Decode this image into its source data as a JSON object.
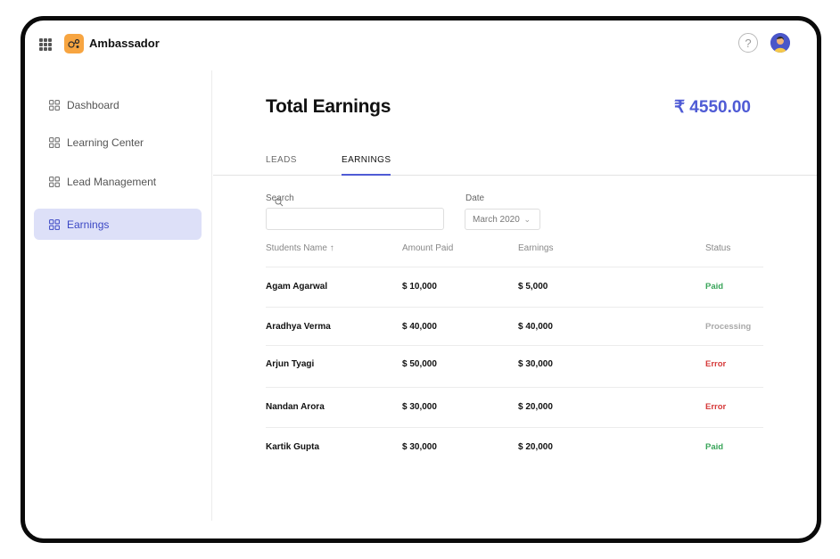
{
  "brand": {
    "name": "Ambassador",
    "logo_color": "#f7a541"
  },
  "header": {
    "help_label": "?"
  },
  "sidebar": {
    "items": [
      {
        "label": "Dashboard",
        "icon": "grid-icon"
      },
      {
        "label": "Learning Center",
        "icon": "grid-icon"
      },
      {
        "label": "Lead Management",
        "icon": "grid-icon"
      },
      {
        "label": "Earnings",
        "icon": "grid-icon",
        "active": true
      }
    ]
  },
  "main": {
    "title": "Total Earnings",
    "total": "₹ 4550.00",
    "tabs": [
      {
        "label": "LEADS"
      },
      {
        "label": "EARNINGS",
        "active": true
      }
    ],
    "search": {
      "label": "Search",
      "value": "",
      "placeholder": ""
    },
    "date": {
      "label": "Date",
      "value": "March 2020"
    }
  },
  "table": {
    "columns": [
      "Students Name",
      "Amount Paid",
      "Earnings",
      "Status"
    ],
    "sort_indicator": "↑",
    "rows": [
      {
        "name": "Agam Agarwal",
        "amount": "$ 10,000",
        "earnings": "$ 5,000",
        "status": "Paid"
      },
      {
        "name": "Aradhya Verma",
        "amount": "$ 40,000",
        "earnings": "$ 40,000",
        "status": "Processing"
      },
      {
        "name": "Arjun Tyagi",
        "amount": "$ 50,000",
        "earnings": "$ 30,000",
        "status": "Error"
      },
      {
        "name": "Nandan Arora",
        "amount": "$ 30,000",
        "earnings": "$ 20,000",
        "status": "Error"
      },
      {
        "name": "Kartik Gupta",
        "amount": "$ 30,000",
        "earnings": "$ 20,000",
        "status": "Paid"
      }
    ]
  },
  "colors": {
    "accent": "#4f5bd5",
    "paid": "#3aa55a",
    "processing": "#a9a9a9",
    "error": "#d63a3a"
  }
}
